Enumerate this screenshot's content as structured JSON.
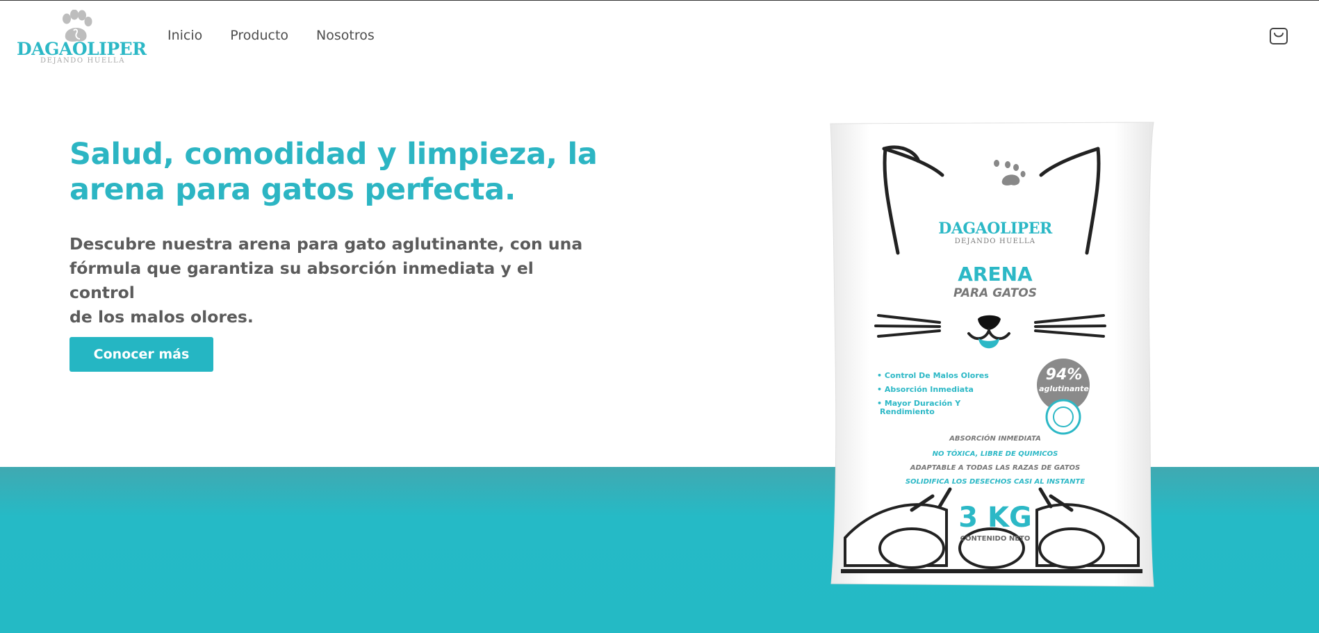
{
  "brand": {
    "name": "DAGAOLIPER",
    "tagline": "DEJANDO  HUELLA"
  },
  "nav": {
    "items": [
      {
        "label": "Inicio"
      },
      {
        "label": "Producto"
      },
      {
        "label": "Nosotros"
      }
    ]
  },
  "hero": {
    "title_line1": "Salud, comodidad y limpieza, la",
    "title_line2": "arena para gatos perfecta.",
    "desc_line1": "Descubre nuestra arena para gato aglutinante, con una",
    "desc_line2": "fórmula que garantiza su absorción inmediata y el control",
    "desc_line3": "de los malos olores.",
    "cta_label": "Conocer más"
  },
  "product": {
    "brand": "DAGAOLIPER",
    "brand_sub": "DEJANDO  HUELLA",
    "name": "ARENA",
    "subname": "PARA GATOS",
    "features": [
      "• Control De Malos Olores",
      "• Absorción Inmediata",
      "• Mayor Duración Y",
      "Rendimiento"
    ],
    "badge_percent": "94%",
    "badge_label": "aglutinante",
    "claims": [
      "ABSORCIÓN INMEDIATA",
      "NO TÓXICA, LIBRE DE QUIMICOS",
      "ADAPTABLE A TODAS LAS RAZAS DE GATOS",
      "SOLIDIFICA LOS DESECHOS CASI AL INSTANTE"
    ],
    "weight": "3 KG",
    "weight_label": "CONTENIDO NETO"
  },
  "colors": {
    "accent": "#2cb5c3",
    "button": "#25b6c3",
    "band": "#24bac5",
    "text": "#5b5b5b"
  },
  "icons": {
    "logo": "paw-print-icon",
    "cart": "shopping-bag-icon"
  }
}
